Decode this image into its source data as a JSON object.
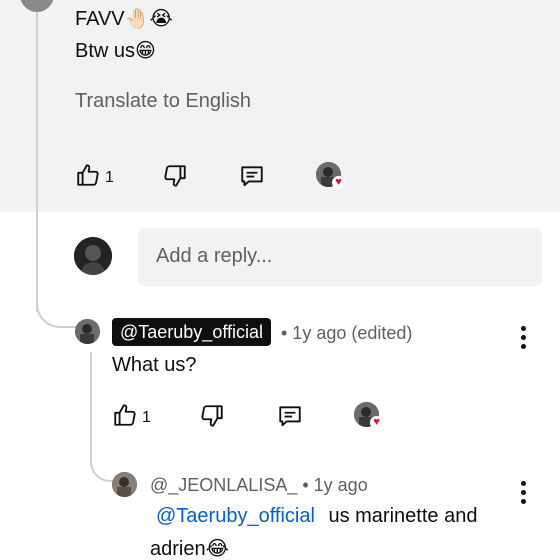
{
  "parent_comment": {
    "line1": "FAVV",
    "line1_emoji": "🤚🏻😭",
    "line2": "Btw us",
    "line2_emoji": "😁",
    "translate": "Translate to English",
    "like_count": "1"
  },
  "reply_input": {
    "placeholder": "Add a reply..."
  },
  "reply_1": {
    "handle": "@Taeruby_official",
    "meta": "• 1y ago (edited)",
    "text": "What us?",
    "like_count": "1"
  },
  "reply_2": {
    "handle": "@_JEONLALISA_",
    "meta": "• 1y ago",
    "mention": "@Taeruby_official",
    "text_part1": "us marinette and",
    "text_part2": "adrien",
    "text_emoji": "😂"
  },
  "colors": {
    "highlight_bg": "#f2f2f2",
    "mention": "#065fd4",
    "heart": "#e5102a",
    "chip_bg": "#0f0f0f"
  }
}
